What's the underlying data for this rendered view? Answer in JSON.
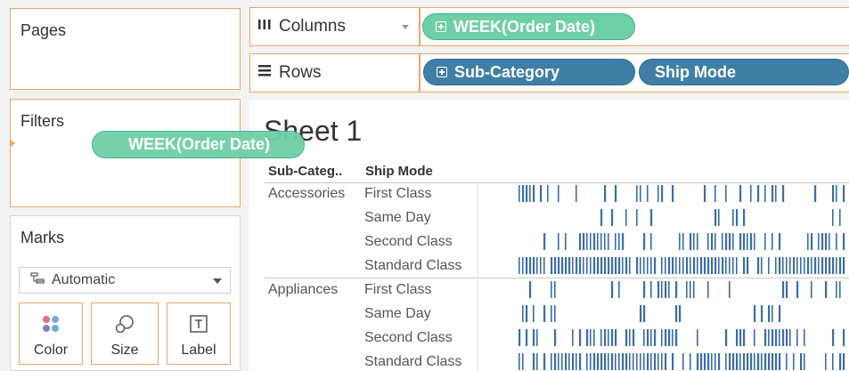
{
  "cards": {
    "pages": "Pages",
    "filters": "Filters",
    "marks": "Marks"
  },
  "shelves": {
    "columns_label": "Columns",
    "rows_label": "Rows",
    "columns_pills": [
      "WEEK(Order Date)"
    ],
    "rows_pills": [
      "Sub-Category",
      "Ship Mode"
    ]
  },
  "dragging_pill": "WEEK(Order Date)",
  "marks": {
    "type": "Automatic",
    "buttons": [
      "Color",
      "Size",
      "Label"
    ]
  },
  "sheet": {
    "title": "Sheet 1",
    "headers": [
      "Sub-Categ..",
      "Ship Mode"
    ],
    "groups": [
      {
        "name": "Accessories",
        "modes": [
          "First Class",
          "Same Day",
          "Second Class",
          "Standard Class"
        ]
      },
      {
        "name": "Appliances",
        "modes": [
          "First Class",
          "Same Day",
          "Second Class",
          "Standard Class"
        ]
      }
    ]
  },
  "colors": {
    "shelf_pill": "#3f7fa6",
    "drag_pill": "#6fcfa6",
    "card_border": "#f0a468",
    "bar": "#3b6ea5"
  }
}
